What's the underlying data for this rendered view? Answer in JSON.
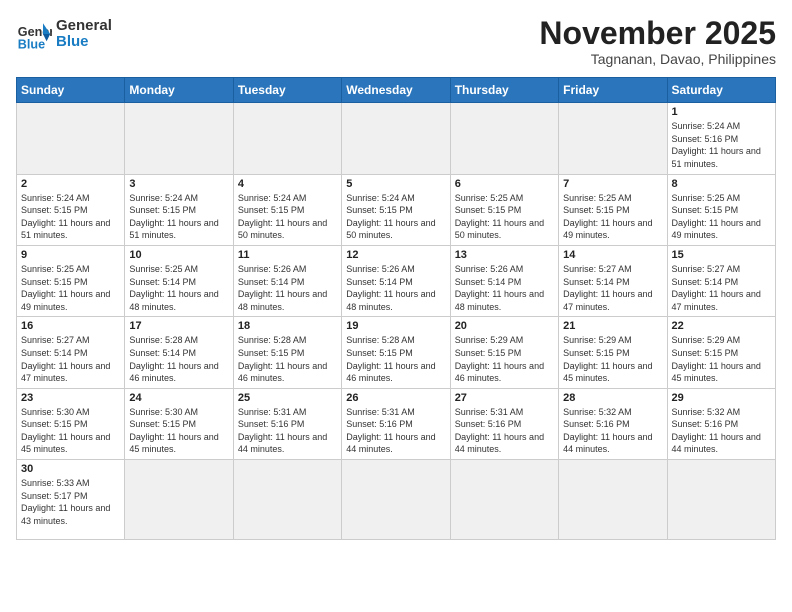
{
  "header": {
    "logo_general": "General",
    "logo_blue": "Blue",
    "month_year": "November 2025",
    "location": "Tagnanan, Davao, Philippines"
  },
  "weekdays": [
    "Sunday",
    "Monday",
    "Tuesday",
    "Wednesday",
    "Thursday",
    "Friday",
    "Saturday"
  ],
  "weeks": [
    [
      {
        "day": "",
        "empty": true
      },
      {
        "day": "",
        "empty": true
      },
      {
        "day": "",
        "empty": true
      },
      {
        "day": "",
        "empty": true
      },
      {
        "day": "",
        "empty": true
      },
      {
        "day": "",
        "empty": true
      },
      {
        "day": "1",
        "sunrise": "5:24 AM",
        "sunset": "5:16 PM",
        "daylight": "11 hours and 51 minutes."
      }
    ],
    [
      {
        "day": "2",
        "sunrise": "5:24 AM",
        "sunset": "5:15 PM",
        "daylight": "11 hours and 51 minutes."
      },
      {
        "day": "3",
        "sunrise": "5:24 AM",
        "sunset": "5:15 PM",
        "daylight": "11 hours and 51 minutes."
      },
      {
        "day": "4",
        "sunrise": "5:24 AM",
        "sunset": "5:15 PM",
        "daylight": "11 hours and 50 minutes."
      },
      {
        "day": "5",
        "sunrise": "5:24 AM",
        "sunset": "5:15 PM",
        "daylight": "11 hours and 50 minutes."
      },
      {
        "day": "6",
        "sunrise": "5:25 AM",
        "sunset": "5:15 PM",
        "daylight": "11 hours and 50 minutes."
      },
      {
        "day": "7",
        "sunrise": "5:25 AM",
        "sunset": "5:15 PM",
        "daylight": "11 hours and 49 minutes."
      },
      {
        "day": "8",
        "sunrise": "5:25 AM",
        "sunset": "5:15 PM",
        "daylight": "11 hours and 49 minutes."
      }
    ],
    [
      {
        "day": "9",
        "sunrise": "5:25 AM",
        "sunset": "5:15 PM",
        "daylight": "11 hours and 49 minutes."
      },
      {
        "day": "10",
        "sunrise": "5:25 AM",
        "sunset": "5:14 PM",
        "daylight": "11 hours and 48 minutes."
      },
      {
        "day": "11",
        "sunrise": "5:26 AM",
        "sunset": "5:14 PM",
        "daylight": "11 hours and 48 minutes."
      },
      {
        "day": "12",
        "sunrise": "5:26 AM",
        "sunset": "5:14 PM",
        "daylight": "11 hours and 48 minutes."
      },
      {
        "day": "13",
        "sunrise": "5:26 AM",
        "sunset": "5:14 PM",
        "daylight": "11 hours and 48 minutes."
      },
      {
        "day": "14",
        "sunrise": "5:27 AM",
        "sunset": "5:14 PM",
        "daylight": "11 hours and 47 minutes."
      },
      {
        "day": "15",
        "sunrise": "5:27 AM",
        "sunset": "5:14 PM",
        "daylight": "11 hours and 47 minutes."
      }
    ],
    [
      {
        "day": "16",
        "sunrise": "5:27 AM",
        "sunset": "5:14 PM",
        "daylight": "11 hours and 47 minutes."
      },
      {
        "day": "17",
        "sunrise": "5:28 AM",
        "sunset": "5:14 PM",
        "daylight": "11 hours and 46 minutes."
      },
      {
        "day": "18",
        "sunrise": "5:28 AM",
        "sunset": "5:15 PM",
        "daylight": "11 hours and 46 minutes."
      },
      {
        "day": "19",
        "sunrise": "5:28 AM",
        "sunset": "5:15 PM",
        "daylight": "11 hours and 46 minutes."
      },
      {
        "day": "20",
        "sunrise": "5:29 AM",
        "sunset": "5:15 PM",
        "daylight": "11 hours and 46 minutes."
      },
      {
        "day": "21",
        "sunrise": "5:29 AM",
        "sunset": "5:15 PM",
        "daylight": "11 hours and 45 minutes."
      },
      {
        "day": "22",
        "sunrise": "5:29 AM",
        "sunset": "5:15 PM",
        "daylight": "11 hours and 45 minutes."
      }
    ],
    [
      {
        "day": "23",
        "sunrise": "5:30 AM",
        "sunset": "5:15 PM",
        "daylight": "11 hours and 45 minutes."
      },
      {
        "day": "24",
        "sunrise": "5:30 AM",
        "sunset": "5:15 PM",
        "daylight": "11 hours and 45 minutes."
      },
      {
        "day": "25",
        "sunrise": "5:31 AM",
        "sunset": "5:16 PM",
        "daylight": "11 hours and 44 minutes."
      },
      {
        "day": "26",
        "sunrise": "5:31 AM",
        "sunset": "5:16 PM",
        "daylight": "11 hours and 44 minutes."
      },
      {
        "day": "27",
        "sunrise": "5:31 AM",
        "sunset": "5:16 PM",
        "daylight": "11 hours and 44 minutes."
      },
      {
        "day": "28",
        "sunrise": "5:32 AM",
        "sunset": "5:16 PM",
        "daylight": "11 hours and 44 minutes."
      },
      {
        "day": "29",
        "sunrise": "5:32 AM",
        "sunset": "5:16 PM",
        "daylight": "11 hours and 44 minutes."
      }
    ],
    [
      {
        "day": "30",
        "sunrise": "5:33 AM",
        "sunset": "5:17 PM",
        "daylight": "11 hours and 43 minutes."
      },
      {
        "day": "",
        "empty": true
      },
      {
        "day": "",
        "empty": true
      },
      {
        "day": "",
        "empty": true
      },
      {
        "day": "",
        "empty": true
      },
      {
        "day": "",
        "empty": true
      },
      {
        "day": "",
        "empty": true
      }
    ]
  ],
  "labels": {
    "sunrise": "Sunrise:",
    "sunset": "Sunset:",
    "daylight": "Daylight:"
  }
}
